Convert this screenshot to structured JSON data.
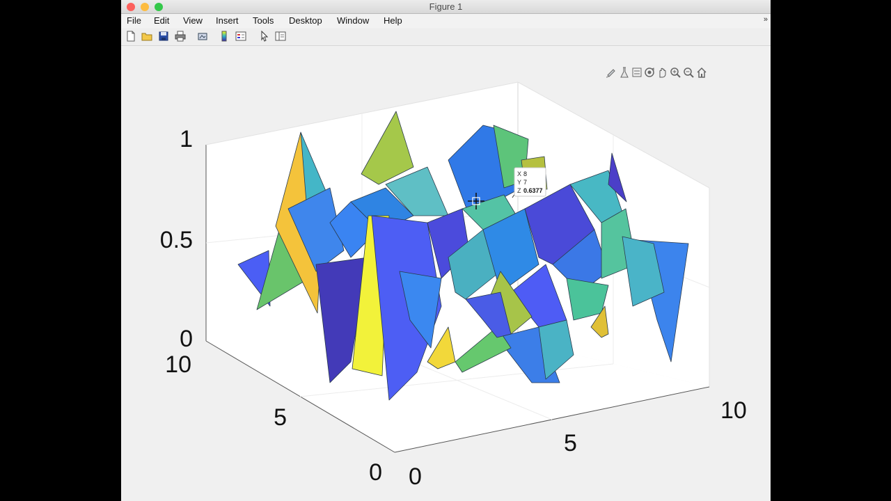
{
  "window": {
    "title": "Figure 1",
    "traffic_lights": [
      "close",
      "minimize",
      "zoom"
    ],
    "colors": {
      "close": "#fc605c",
      "minimize": "#fdbc40",
      "zoom": "#34c84a"
    }
  },
  "menubar": {
    "items": [
      "File",
      "Edit",
      "View",
      "Insert",
      "Tools",
      "Desktop",
      "Window",
      "Help"
    ],
    "overflow": "»"
  },
  "toolbar": {
    "icons": [
      "new-figure-icon",
      "open-file-icon",
      "save-icon",
      "print-icon",
      "link-plot-icon",
      "insert-colorbar-icon",
      "insert-legend-icon",
      "edit-plot-icon",
      "property-inspector-icon"
    ]
  },
  "axes_toolbar": {
    "icons": [
      "brush-icon",
      "data-tips-icon",
      "rotate-3d-icon",
      "pan-icon",
      "zoom-in-icon",
      "zoom-out-icon",
      "restore-view-icon"
    ]
  },
  "axes": {
    "x_ticks": [
      "0",
      "5",
      "10"
    ],
    "y_ticks": [
      "0",
      "5",
      "10"
    ],
    "z_ticks": [
      "0",
      "0.5",
      "1"
    ]
  },
  "datatip": {
    "x_label": "X",
    "x_value": "8",
    "y_label": "Y",
    "y_value": "7",
    "z_label": "Z",
    "z_value": "0.6377"
  },
  "chart_data": {
    "type": "surface",
    "colormap": "parula",
    "xlim": [
      0,
      10
    ],
    "ylim": [
      0,
      10
    ],
    "zlim": [
      0,
      1
    ],
    "grid": true,
    "highlighted_point": {
      "x": 8,
      "y": 7,
      "z": 0.6377
    }
  }
}
